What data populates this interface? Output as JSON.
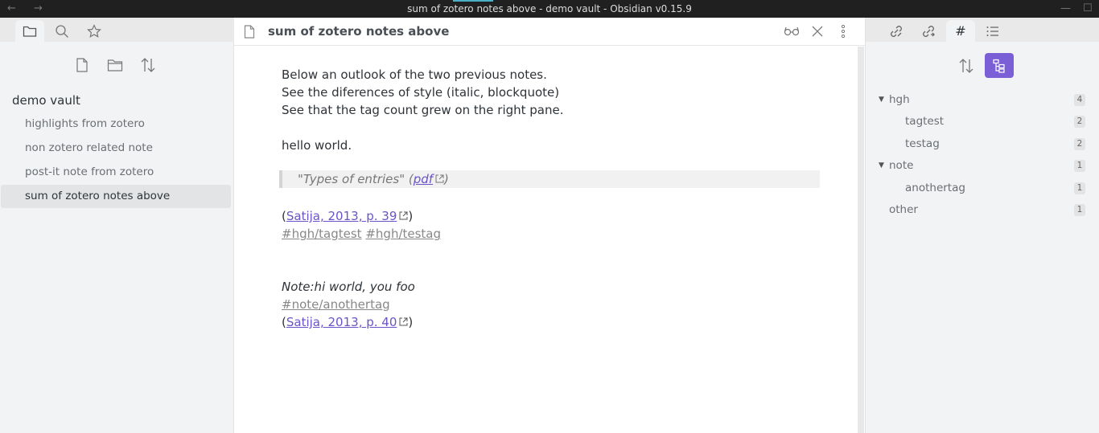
{
  "window": {
    "title": "sum of zotero notes above - demo vault - Obsidian v0.15.9",
    "back_glyph": "←",
    "forward_glyph": "→",
    "minimize_glyph": "—",
    "maximize_glyph": "☐"
  },
  "left_sidebar": {
    "tabs": [
      {
        "icon": "folder-icon",
        "active": true
      },
      {
        "icon": "search-icon",
        "active": false
      },
      {
        "icon": "star-icon",
        "active": false
      }
    ],
    "actions": [
      "new-note-icon",
      "new-folder-icon",
      "sort-icon"
    ],
    "vault_name": "demo vault",
    "files": [
      {
        "label": "highlights from zotero",
        "active": false
      },
      {
        "label": "non zotero related note",
        "active": false
      },
      {
        "label": "post-it note from zotero",
        "active": false
      },
      {
        "label": "sum of zotero notes above",
        "active": true
      }
    ]
  },
  "editor": {
    "title": "sum of zotero notes above",
    "lines": {
      "l1": "Below an outlook of the two previous notes.",
      "l2": "See the diferences of style (italic, blockquote)",
      "l3": "See that the tag count grew on the right pane.",
      "l4": "hello world.",
      "quote_text": "\"Types of entries\"",
      "quote_open": " (",
      "quote_link": "pdf",
      "quote_close": ")",
      "cite1_open": "(",
      "cite1_link": "Satija, 2013, p. 39",
      "cite1_close": ")",
      "tag1": "#hgh/tagtest",
      "tag2": "#hgh/testag",
      "note": "Note:hi world, you foo",
      "tag3": "#note/anothertag",
      "cite2_open": "(",
      "cite2_link": "Satija, 2013, p. 40",
      "cite2_close": ")"
    }
  },
  "right_sidebar": {
    "tabs": [
      {
        "icon": "backlinks-icon",
        "active": false
      },
      {
        "icon": "outgoing-links-icon",
        "active": false
      },
      {
        "icon": "tag-hash-icon",
        "label": "#",
        "active": true
      },
      {
        "icon": "outline-icon",
        "active": false
      }
    ],
    "actions": [
      "sort-icon",
      "tree-view-icon"
    ],
    "tags": [
      {
        "label": "hgh",
        "count": "4",
        "level": 0,
        "expanded": true
      },
      {
        "label": "tagtest",
        "count": "2",
        "level": 1
      },
      {
        "label": "testag",
        "count": "2",
        "level": 1
      },
      {
        "label": "note",
        "count": "1",
        "level": 0,
        "expanded": true
      },
      {
        "label": "anothertag",
        "count": "1",
        "level": 1
      },
      {
        "label": "other",
        "count": "1",
        "level": 0
      }
    ],
    "accent_color": "#7b5fd6"
  }
}
